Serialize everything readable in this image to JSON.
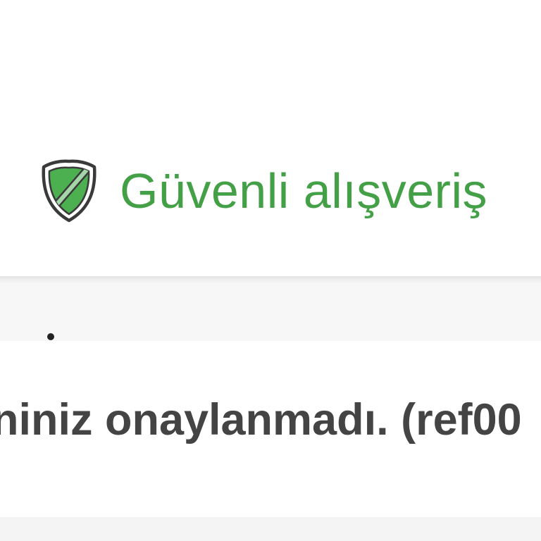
{
  "secure_badge": {
    "icon": "shield-icon",
    "label": "Güvenli alışveriş",
    "color": "#43a047",
    "icon_fill": "#4caf50",
    "icon_stroke": "#3a3a3a"
  },
  "message": {
    "bullet": "•",
    "text": "niniz onaylanmadı. (ref00"
  },
  "colors": {
    "text_dark": "#444444",
    "band_gray": "#f7f7f7"
  }
}
